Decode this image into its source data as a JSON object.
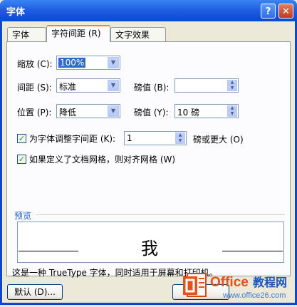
{
  "window": {
    "title": "字体",
    "help_glyph": "?",
    "close_glyph": "✕"
  },
  "tabs": [
    {
      "label": "字体 (N)"
    },
    {
      "label": "字符间距 (R)",
      "active": true
    },
    {
      "label": "文字效果 (X)"
    }
  ],
  "scale": {
    "label": "缩放 (C):",
    "value": "100%"
  },
  "spacing": {
    "label": "间距 (S):",
    "value": "标准",
    "by_label": "磅值 (B):",
    "by_value": ""
  },
  "position": {
    "label": "位置 (P):",
    "value": "降低",
    "by_label": "磅值 (Y):",
    "by_value": "10 磅"
  },
  "kerning": {
    "label": "为字体调整字间距 (K):",
    "value": "1",
    "suffix": "磅或更大 (O)",
    "checked": true
  },
  "grid": {
    "label": "如果定义了文档网格，则对齐网格 (W)",
    "checked": true
  },
  "preview": {
    "label": "预览",
    "sample": "我",
    "note": "这是一种 TrueType 字体，同时适用于屏幕和打印机。"
  },
  "buttons": {
    "default": "默认 (D)..."
  },
  "watermark": {
    "brand": "Office教程网",
    "url": "www.office26.com"
  }
}
